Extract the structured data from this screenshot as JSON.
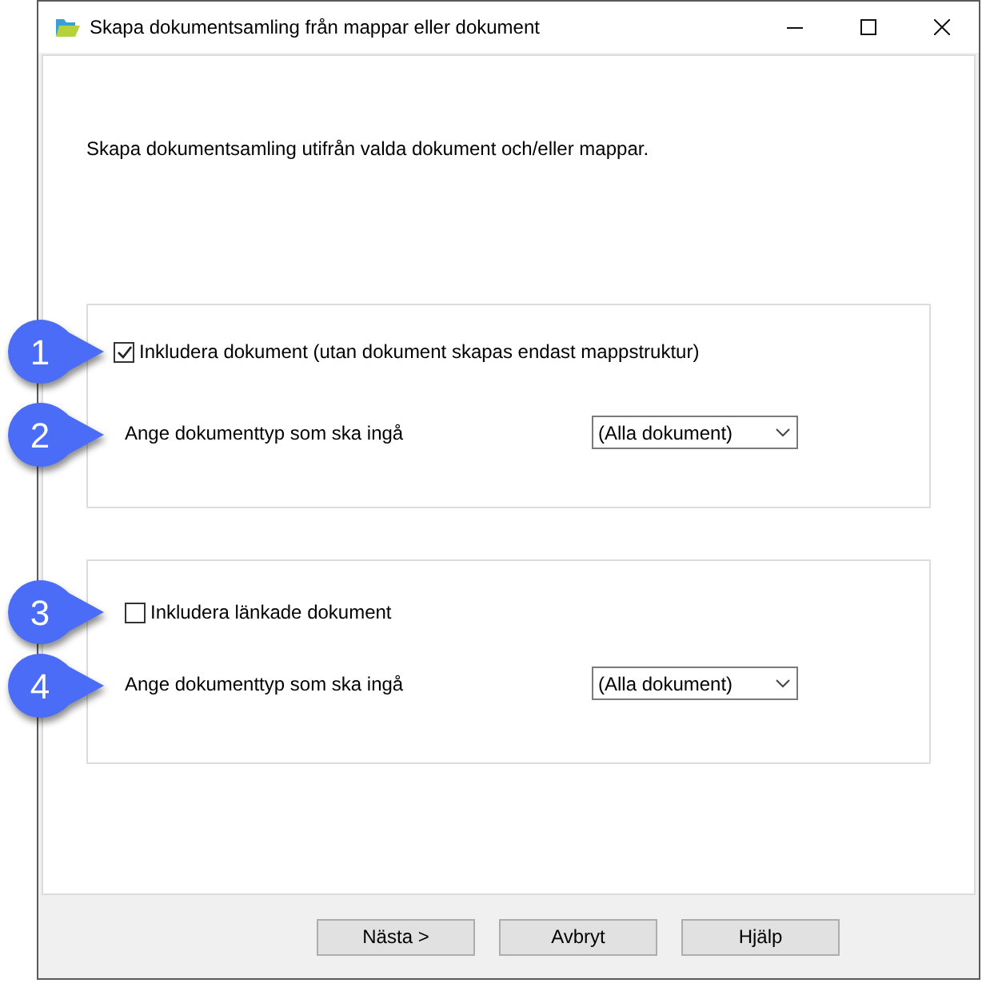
{
  "window": {
    "title": "Skapa dokumentsamling från mappar eller dokument"
  },
  "intro": "Skapa dokumentsamling utifrån valda dokument och/eller mappar.",
  "groups": [
    {
      "checkbox": {
        "label": "Inkludera dokument (utan dokument skapas endast mappstruktur)",
        "checked": true,
        "callout": "1"
      },
      "type_row": {
        "label": "Ange dokumenttyp som ska ingå",
        "value": "(Alla dokument)",
        "callout": "2"
      }
    },
    {
      "checkbox": {
        "label": "Inkludera länkade dokument",
        "checked": false,
        "callout": "3"
      },
      "type_row": {
        "label": "Ange dokumenttyp som ska ingå",
        "value": "(Alla dokument)",
        "callout": "4"
      }
    }
  ],
  "buttons": [
    "Nästa >",
    "Avbryt",
    "Hjälp"
  ]
}
